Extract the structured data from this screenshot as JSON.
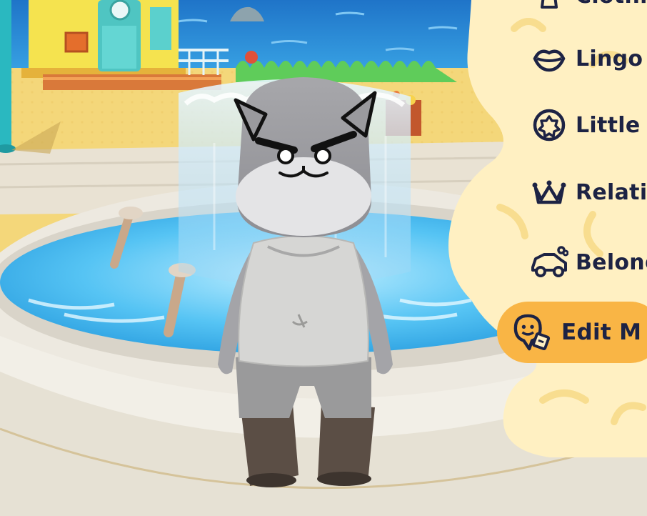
{
  "menu": {
    "items": [
      {
        "id": "clothing",
        "label": "Clothin",
        "icon": "dress-icon"
      },
      {
        "id": "lingo",
        "label": "Lingo",
        "icon": "lips-icon"
      },
      {
        "id": "little",
        "label": "Little d",
        "icon": "flower-badge-icon"
      },
      {
        "id": "relations",
        "label": "Relatio",
        "icon": "crown-icon"
      },
      {
        "id": "belongings",
        "label": "Belong",
        "icon": "car-toy-icon"
      },
      {
        "id": "edit",
        "label": "Edit M",
        "icon": "mii-edit-icon",
        "selected": true
      }
    ]
  },
  "colors": {
    "panel": "#fff0c2",
    "panel_pattern": "#f8dd8f",
    "selected_pill": "#f9b545",
    "menu_text": "#1d2344",
    "sea": "#2f8fd8",
    "sand": "#f4d77a",
    "water": "#5ec3f2"
  }
}
